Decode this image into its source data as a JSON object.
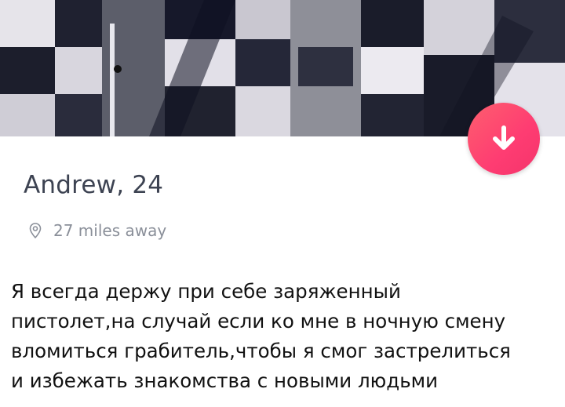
{
  "profile": {
    "name_age": "Andrew, 24",
    "distance": "27 miles away",
    "location_icon": "map-pin-icon",
    "action_icon": "arrow-down-icon"
  },
  "caption": {
    "text": "Я всегда держу при себе заряженный\nпистолет,на случай если ко мне в ночную смену\nвломиться грабитель,чтобы я смог застрелиться\nи избежать знакомства с новыми людьми"
  },
  "colors": {
    "accent": "#fe3c72",
    "name_text": "#3d4352",
    "meta_text": "#8a8f99"
  }
}
